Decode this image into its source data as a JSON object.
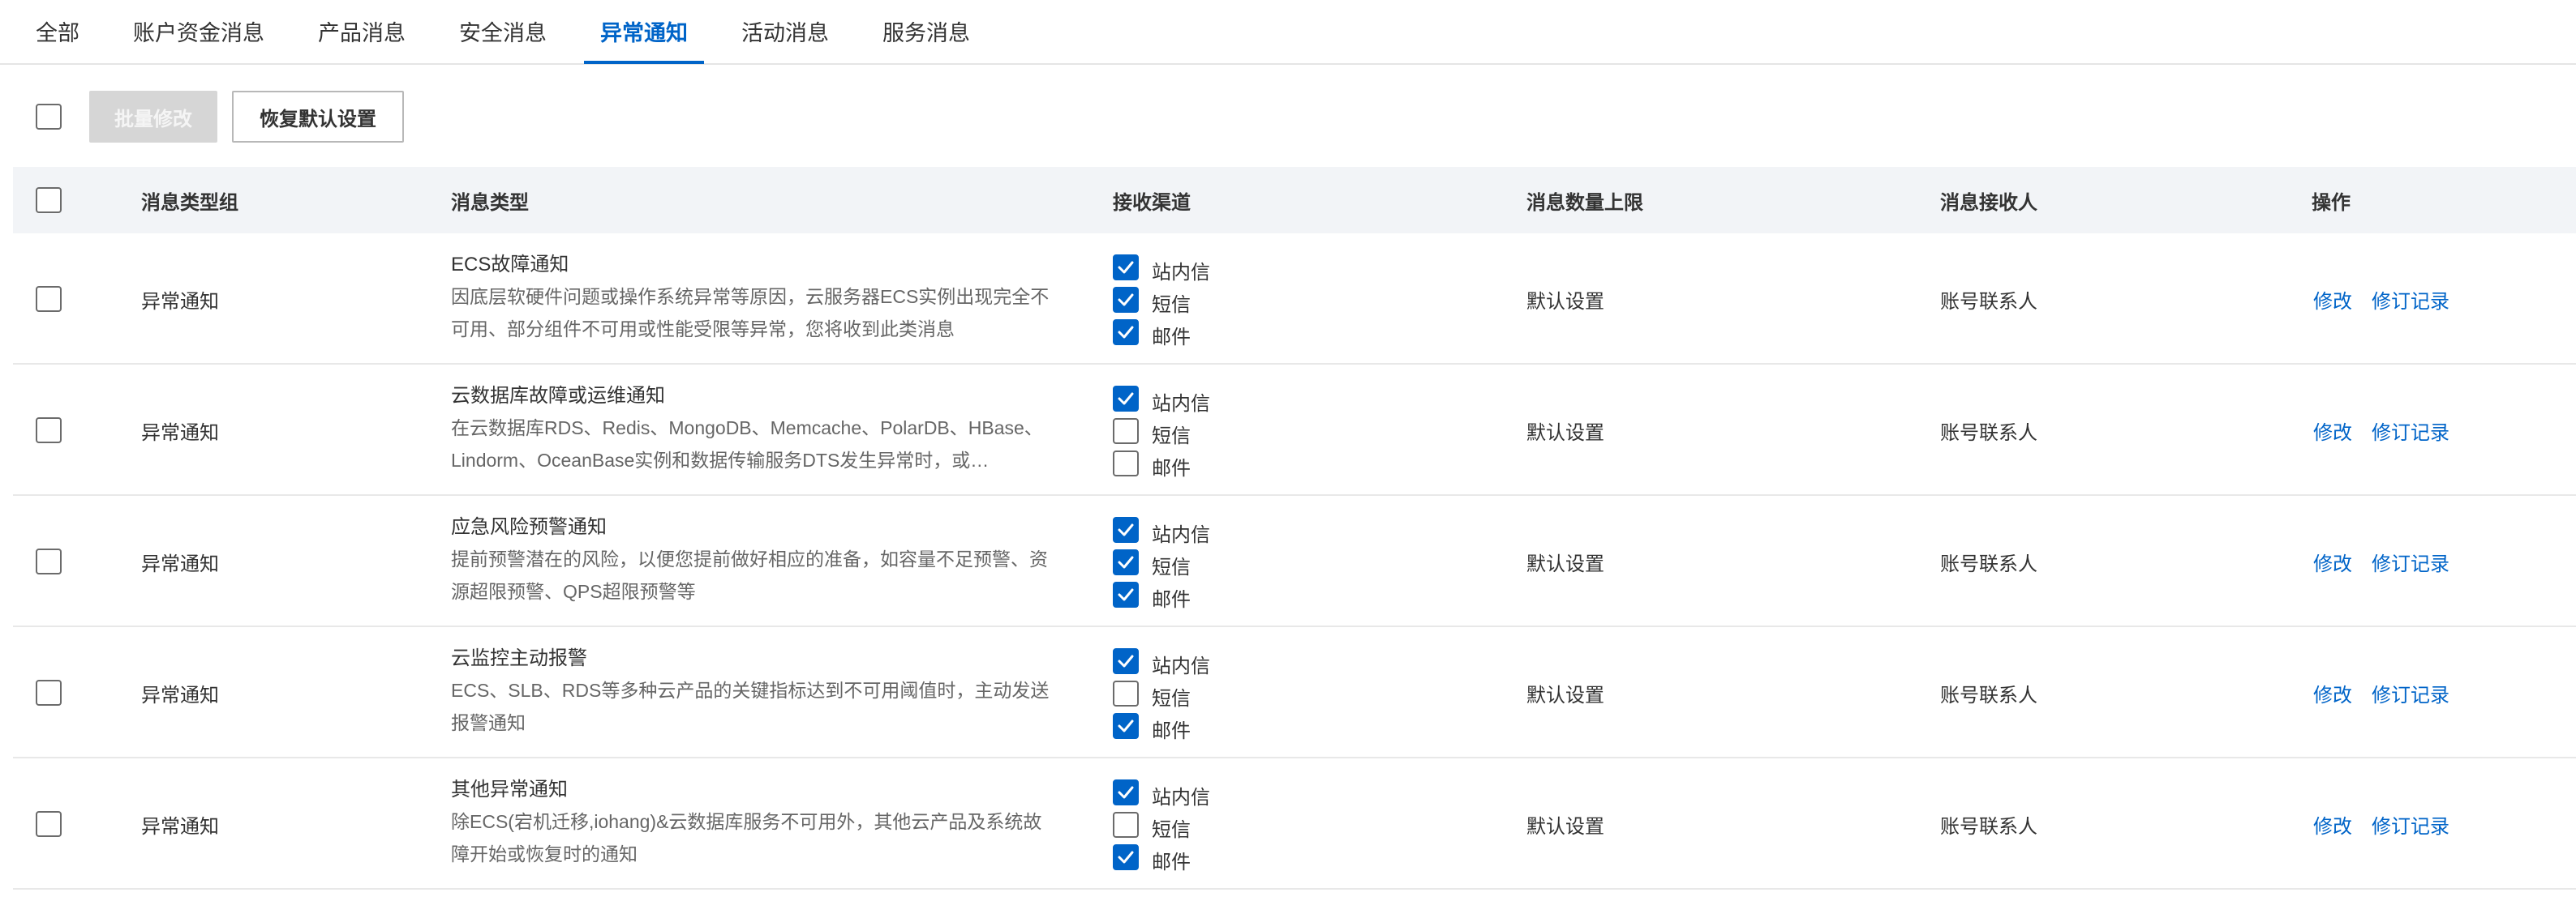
{
  "tabs": [
    {
      "label": "全部",
      "active": false
    },
    {
      "label": "账户资金消息",
      "active": false
    },
    {
      "label": "产品消息",
      "active": false
    },
    {
      "label": "安全消息",
      "active": false
    },
    {
      "label": "异常通知",
      "active": true
    },
    {
      "label": "活动消息",
      "active": false
    },
    {
      "label": "服务消息",
      "active": false
    }
  ],
  "toolbar": {
    "batch_edit_label": "批量修改",
    "batch_edit_disabled": true,
    "restore_default_label": "恢复默认设置"
  },
  "table": {
    "headers": {
      "group": "消息类型组",
      "type": "消息类型",
      "channel": "接收渠道",
      "limit": "消息数量上限",
      "recipient": "消息接收人",
      "actions": "操作"
    },
    "channel_names": [
      "站内信",
      "短信",
      "邮件"
    ],
    "action_labels": {
      "edit": "修改",
      "history": "修订记录"
    },
    "rows": [
      {
        "group": "异常通知",
        "title": "ECS故障通知",
        "desc": "因底层软硬件问题或操作系统异常等原因，云服务器ECS实例出现完全不可用、部分组件不可用或性能受限等异常，您将收到此类消息",
        "channels": [
          true,
          true,
          true
        ],
        "limit": "默认设置",
        "recipient": "账号联系人"
      },
      {
        "group": "异常通知",
        "title": "云数据库故障或运维通知",
        "desc": "在云数据库RDS、Redis、MongoDB、Memcache、PolarDB、HBase、Lindorm、OceanBase实例和数据传输服务DTS发生异常时，或…",
        "channels": [
          true,
          false,
          false
        ],
        "limit": "默认设置",
        "recipient": "账号联系人"
      },
      {
        "group": "异常通知",
        "title": "应急风险预警通知",
        "desc": "提前预警潜在的风险，以便您提前做好相应的准备，如容量不足预警、资源超限预警、QPS超限预警等",
        "channels": [
          true,
          true,
          true
        ],
        "limit": "默认设置",
        "recipient": "账号联系人"
      },
      {
        "group": "异常通知",
        "title": "云监控主动报警",
        "desc": "ECS、SLB、RDS等多种云产品的关键指标达到不可用阈值时，主动发送报警通知",
        "channels": [
          true,
          false,
          true
        ],
        "limit": "默认设置",
        "recipient": "账号联系人"
      },
      {
        "group": "异常通知",
        "title": "其他异常通知",
        "desc": "除ECS(宕机迁移,iohang)&云数据库服务不可用外，其他云产品及系统故障开始或恢复时的通知",
        "channels": [
          true,
          false,
          true
        ],
        "limit": "默认设置",
        "recipient": "账号联系人"
      }
    ]
  },
  "colors": {
    "accent": "#0064c8",
    "header_bg": "#f2f4f7",
    "disabled_button": "#d6d6d6"
  }
}
